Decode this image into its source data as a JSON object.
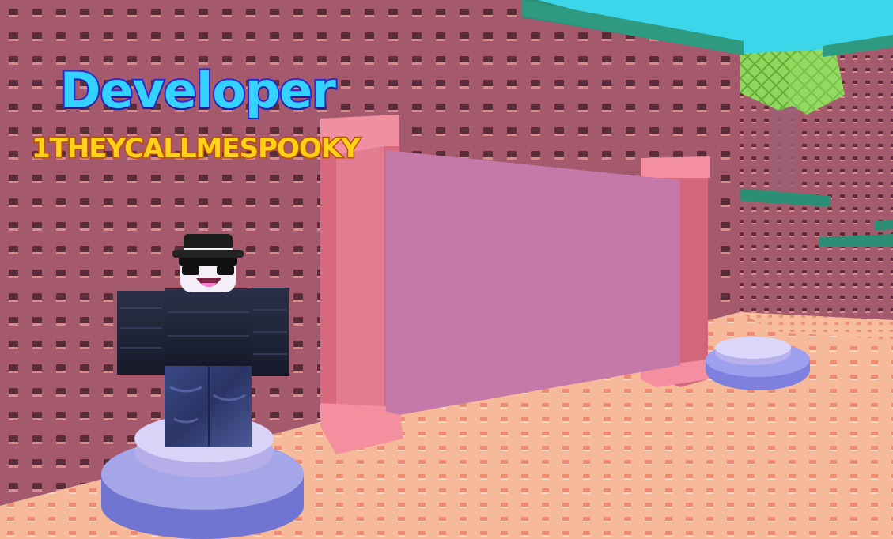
{
  "billboard": {
    "title": "Developer",
    "name": "1THEYCALLMESPOOKY"
  },
  "colors": {
    "sky": "#3cd6ea",
    "wall": "#a45a6c",
    "floor": "#f6ba9a",
    "frame": "#eb7f91",
    "screen": "#c579a9",
    "title_fill": "#33d2ff",
    "title_stroke": "#2b2ad6",
    "name_fill": "#ffd11a",
    "name_stroke": "#c24d05",
    "pedestal": "#7d80dc"
  }
}
